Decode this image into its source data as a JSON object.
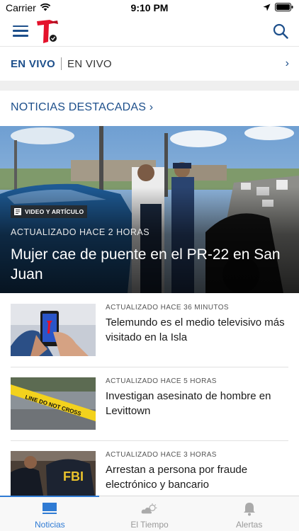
{
  "status_bar": {
    "carrier": "Carrier",
    "time": "9:10 PM"
  },
  "header": {
    "menu_icon": "hamburger-menu-icon",
    "logo_icon": "telemundo-logo",
    "search_icon": "search-icon"
  },
  "live": {
    "badge": "EN VIVO",
    "text": "EN VIVO",
    "chevron": "›"
  },
  "section": {
    "title": "NOTICIAS DESTACADAS ›"
  },
  "hero": {
    "badge": "VIDEO Y ARTÍCULO",
    "meta": "ACTUALIZADO HACE 2 HORAS",
    "title": "Mujer cae de puente en el PR-22 en San Juan"
  },
  "news": [
    {
      "meta": "ACTUALIZADO HACE 36 MINUTOS",
      "title": "Telemundo es el medio televisivo más visitado en la Isla"
    },
    {
      "meta": "ACTUALIZADO HACE 5 HORAS",
      "title": "Investigan asesinato de hombre en Levittown"
    },
    {
      "meta": "ACTUALIZADO HACE 3 HORAS",
      "title": "Arrestan a persona por fraude electrónico y bancario"
    }
  ],
  "thumb_text": {
    "tape": "LINE DO NOT CROSS",
    "fbi": "FBI"
  },
  "tabs": [
    {
      "label": "Noticias",
      "icon": "news-icon",
      "active": true
    },
    {
      "label": "El Tiempo",
      "icon": "weather-icon",
      "active": false
    },
    {
      "label": "Alertas",
      "icon": "bell-icon",
      "active": false
    }
  ],
  "colors": {
    "brand_blue": "#1d4f8b",
    "active_tab": "#2f7bd4",
    "logo_red": "#e4122b"
  }
}
